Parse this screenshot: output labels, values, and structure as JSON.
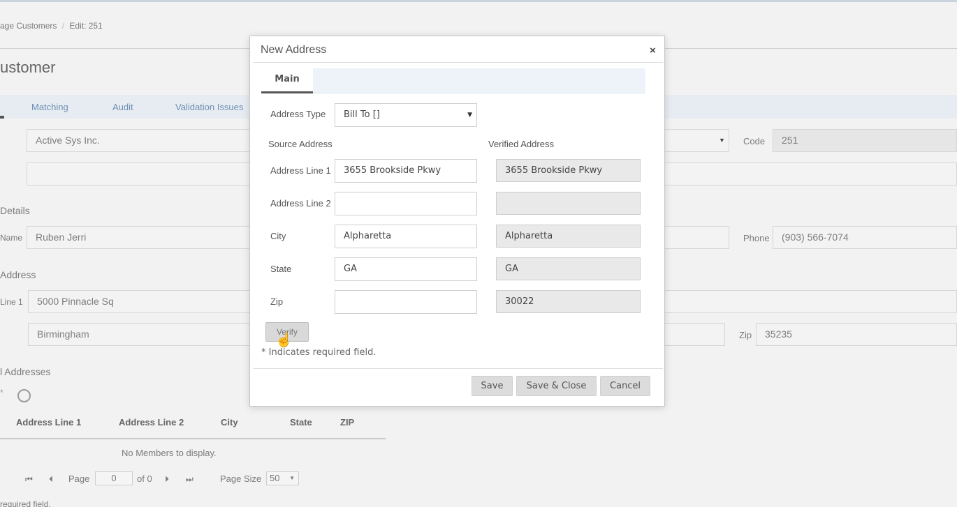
{
  "breadcrumb": {
    "parent": "age Customers",
    "sep": "/",
    "current": "Edit: 251"
  },
  "page_title": "ustomer",
  "bg_tabs": [
    "Matching",
    "Audit",
    "Validation Issues"
  ],
  "customer": {
    "company": "Active Sys Inc.",
    "code_label": "Code",
    "code_value": "251",
    "details_heading": "Details",
    "name_label": "Name",
    "name_value": "Ruben Jerri",
    "phone_label": "Phone",
    "phone_value": "(903) 566-7074",
    "address_heading": "Address",
    "line1_label": "Line 1",
    "line1_value": "5000 Pinnacle Sq",
    "city_value": "Birmingham",
    "zip_label": "Zip",
    "zip_value": "35235"
  },
  "additional": {
    "heading": "l Addresses",
    "columns": [
      "Address Line 1",
      "Address Line 2",
      "City",
      "State",
      "ZIP"
    ],
    "empty": "No Members to display.",
    "pager": {
      "page_label": "Page",
      "page_value": "0",
      "of_label": "of 0",
      "size_label": "Page Size",
      "size_value": "50"
    },
    "footer_note": "required field."
  },
  "modal": {
    "title": "New Address",
    "close": "×",
    "tab_main": "Main",
    "address_type_label": "Address Type",
    "address_type_value": "Bill To []",
    "source_heading": "Source Address",
    "verified_heading": "Verified Address",
    "fields": [
      {
        "label": "Address Line 1",
        "source": "3655 Brookside Pkwy",
        "verified": "3655 Brookside Pkwy"
      },
      {
        "label": "Address Line 2",
        "source": "",
        "verified": ""
      },
      {
        "label": "City",
        "source": "Alpharetta",
        "verified": "Alpharetta"
      },
      {
        "label": "State",
        "source": "GA",
        "verified": "GA"
      },
      {
        "label": "Zip",
        "source": "",
        "verified": "30022"
      }
    ],
    "verify_label": "Verify",
    "required_note": "* Indicates required field.",
    "save_label": "Save",
    "save_close_label": "Save & Close",
    "cancel_label": "Cancel"
  },
  "colors": {
    "tab_text": "#6f8fb3",
    "tab_strip": "#e6ecf2",
    "readonly": "#e9e9e9"
  },
  "icons": [
    "close-icon",
    "dropdown-caret-icon",
    "hand-cursor-icon",
    "refresh-icon",
    "first-page-icon",
    "prev-page-icon",
    "next-page-icon",
    "last-page-icon"
  ]
}
